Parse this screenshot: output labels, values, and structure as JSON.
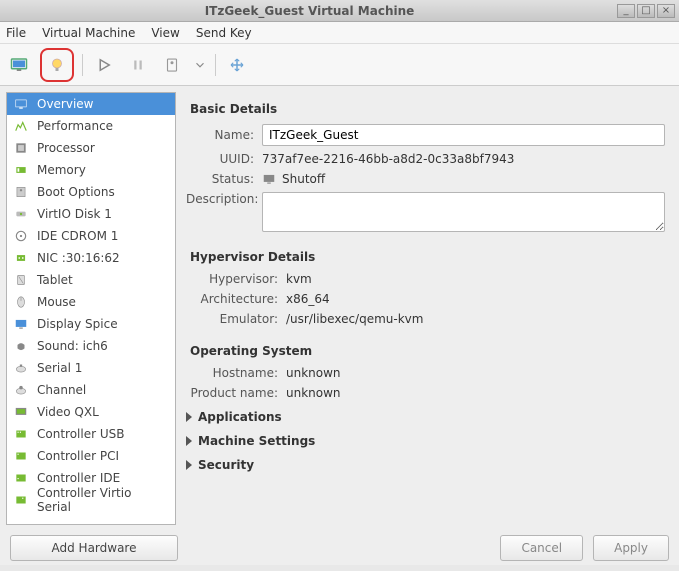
{
  "window": {
    "title": "ITzGeek_Guest Virtual Machine"
  },
  "menu": {
    "file": "File",
    "vm": "Virtual Machine",
    "view": "View",
    "sendkey": "Send Key"
  },
  "sidebar": {
    "items": [
      "Overview",
      "Performance",
      "Processor",
      "Memory",
      "Boot Options",
      "VirtIO Disk 1",
      "IDE CDROM 1",
      "NIC :30:16:62",
      "Tablet",
      "Mouse",
      "Display Spice",
      "Sound: ich6",
      "Serial 1",
      "Channel",
      "Video QXL",
      "Controller USB",
      "Controller PCI",
      "Controller IDE",
      "Controller Virtio Serial"
    ]
  },
  "basic": {
    "heading": "Basic Details",
    "name_label": "Name:",
    "name_value": "ITzGeek_Guest",
    "uuid_label": "UUID:",
    "uuid_value": "737af7ee-2216-46bb-a8d2-0c33a8bf7943",
    "status_label": "Status:",
    "status_value": "Shutoff",
    "desc_label": "Description:"
  },
  "hyper": {
    "heading": "Hypervisor Details",
    "hv_label": "Hypervisor:",
    "hv_value": "kvm",
    "arch_label": "Architecture:",
    "arch_value": "x86_64",
    "emu_label": "Emulator:",
    "emu_value": "/usr/libexec/qemu-kvm"
  },
  "os": {
    "heading": "Operating System",
    "host_label": "Hostname:",
    "host_value": "unknown",
    "prod_label": "Product name:",
    "prod_value": "unknown"
  },
  "expanders": {
    "apps": "Applications",
    "machine": "Machine Settings",
    "security": "Security"
  },
  "footer": {
    "add": "Add Hardware",
    "cancel": "Cancel",
    "apply": "Apply"
  }
}
